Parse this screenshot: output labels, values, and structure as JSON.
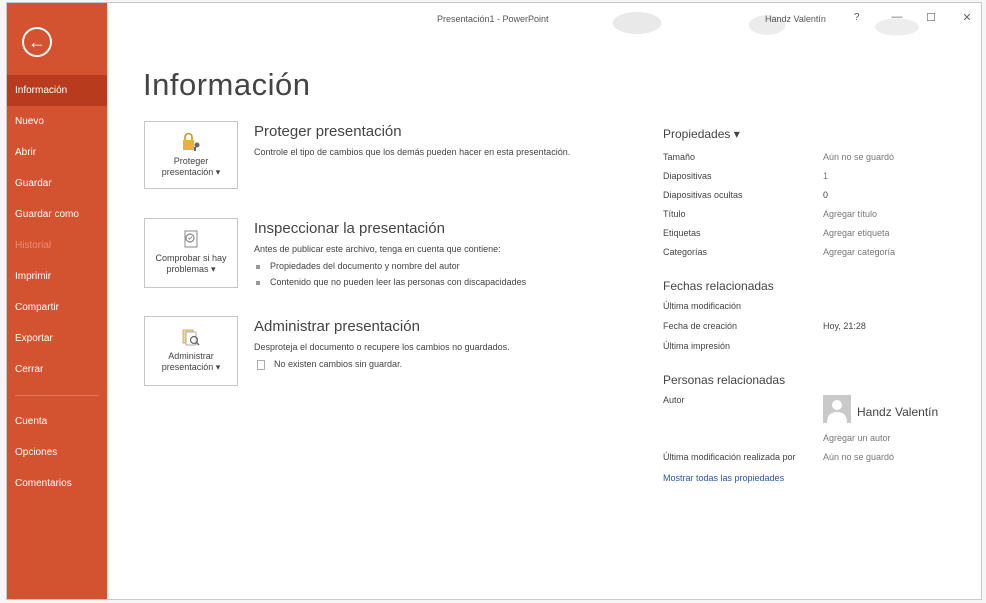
{
  "window": {
    "title": "Presentación1 - PowerPoint",
    "user": "Handz Valentín",
    "help": "?",
    "minimize": "—",
    "maximize": "☐",
    "close": "✕"
  },
  "sidebar": {
    "back_icon": "←",
    "items": [
      {
        "label": "Información",
        "state": "active"
      },
      {
        "label": "Nuevo"
      },
      {
        "label": "Abrir"
      },
      {
        "label": "Guardar"
      },
      {
        "label": "Guardar como"
      },
      {
        "label": "Historial",
        "state": "disabled"
      },
      {
        "label": "Imprimir"
      },
      {
        "label": "Compartir"
      },
      {
        "label": "Exportar"
      },
      {
        "label": "Cerrar"
      }
    ],
    "bottom_items": [
      {
        "label": "Cuenta"
      },
      {
        "label": "Opciones"
      },
      {
        "label": "Comentarios"
      }
    ]
  },
  "main": {
    "title": "Información",
    "cards": [
      {
        "button_label_1": "Proteger",
        "button_label_2": "presentación ▾",
        "title": "Proteger presentación",
        "description": "Controle el tipo de cambios que los demás pueden hacer en esta presentación."
      },
      {
        "button_label_1": "Comprobar si hay",
        "button_label_2": "problemas ▾",
        "title": "Inspeccionar la presentación",
        "description": "Antes de publicar este archivo, tenga en cuenta que contiene:",
        "bullets": [
          "Propiedades del documento y nombre del autor",
          "Contenido que no pueden leer las personas con discapacidades"
        ]
      },
      {
        "button_label_1": "Administrar",
        "button_label_2": "presentación ▾",
        "title": "Administrar presentación",
        "description": "Desproteja el documento o recupere los cambios no guardados.",
        "note": "No existen cambios sin guardar."
      }
    ]
  },
  "properties": {
    "title": "Propiedades ▾",
    "rows": [
      {
        "label": "Tamaño",
        "value": "Aún no se guardó"
      },
      {
        "label": "Diapositivas",
        "value": "1"
      },
      {
        "label": "Diapositivas ocultas",
        "value": "0"
      },
      {
        "label": "Título",
        "value": "Agregar título"
      },
      {
        "label": "Etiquetas",
        "value": "Agregar etiqueta"
      },
      {
        "label": "Categorías",
        "value": "Agregar categoría"
      }
    ],
    "dates_title": "Fechas relacionadas",
    "date_rows": [
      {
        "label": "Última modificación",
        "value": ""
      },
      {
        "label": "Fecha de creación",
        "value": "Hoy, 21:28"
      },
      {
        "label": "Última impresión",
        "value": ""
      }
    ],
    "people_title": "Personas relacionadas",
    "author_label": "Autor",
    "author_name": "Handz Valentín",
    "add_author": "Agregar un autor",
    "last_modified_by_label": "Última modificación realizada por",
    "last_modified_by_value": "Aún no se guardó",
    "show_all": "Mostrar todas las propiedades"
  }
}
